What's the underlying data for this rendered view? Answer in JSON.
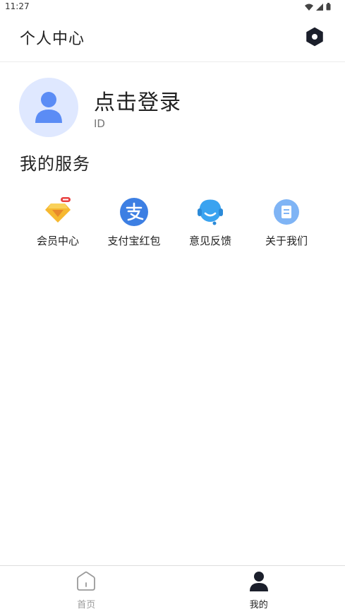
{
  "status_bar": {
    "time": "11:27"
  },
  "header": {
    "title": "个人中心",
    "settings_icon": "settings-hexagon-icon"
  },
  "profile": {
    "login_label": "点击登录",
    "id_label": "ID",
    "avatar_icon": "user-avatar-icon"
  },
  "services": {
    "title": "我的服务",
    "items": [
      {
        "label": "会员中心",
        "icon": "diamond-vip-icon"
      },
      {
        "label": "支付宝红包",
        "icon": "alipay-icon"
      },
      {
        "label": "意见反馈",
        "icon": "customer-service-icon"
      },
      {
        "label": "关于我们",
        "icon": "document-icon"
      }
    ]
  },
  "bottom_nav": {
    "items": [
      {
        "label": "首页",
        "icon": "home-icon",
        "active": false
      },
      {
        "label": "我的",
        "icon": "profile-icon",
        "active": true
      }
    ]
  },
  "colors": {
    "accent_blue": "#5b8cf5",
    "alipay_blue": "#3d7fe3",
    "feedback_blue": "#3aa3f0",
    "vip_orange": "#f5a623",
    "avatar_bg": "#dfe8ff"
  }
}
